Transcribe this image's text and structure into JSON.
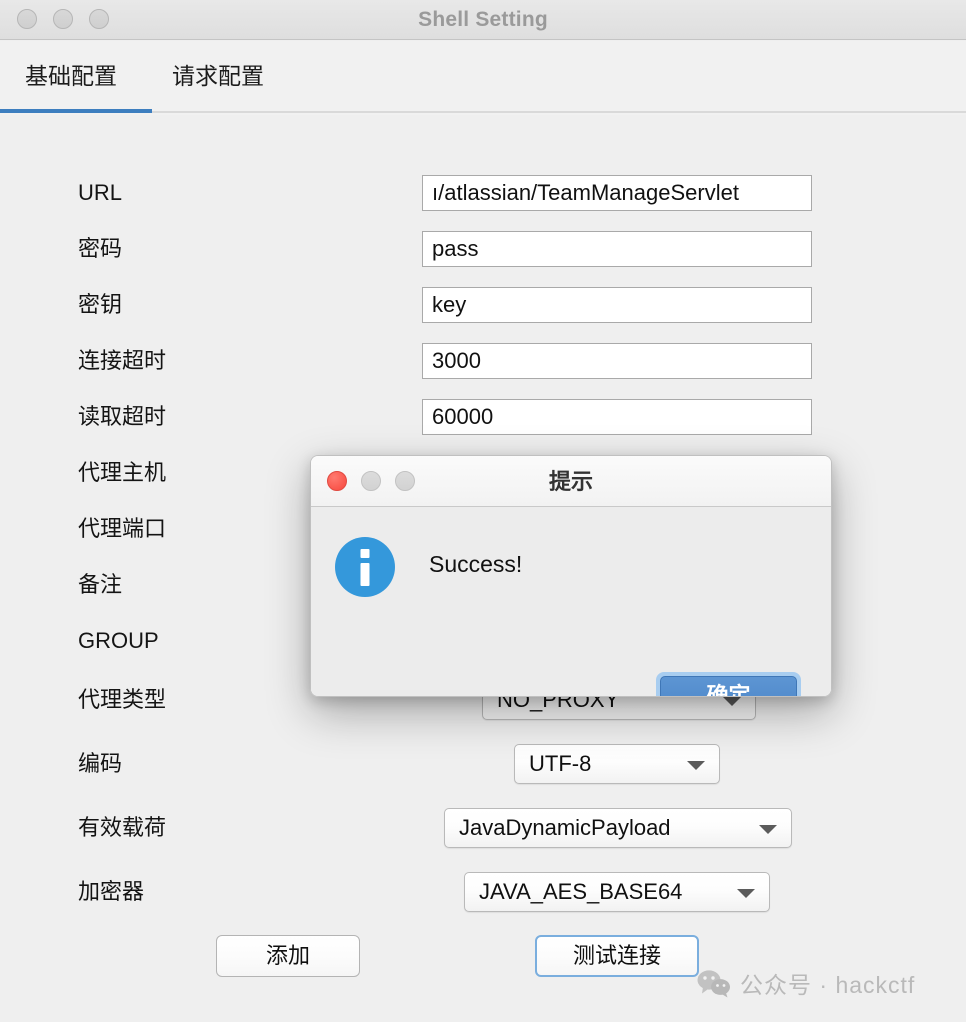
{
  "window": {
    "title": "Shell Setting",
    "traffic_lights": [
      "close-button",
      "minimize-button",
      "zoom-button"
    ]
  },
  "tabs": [
    {
      "label": "基础配置",
      "active": true
    },
    {
      "label": "请求配置",
      "active": false
    }
  ],
  "form": {
    "rows": [
      {
        "label": "URL",
        "type": "text",
        "value": "ı/atlassian/TeamManageServlet"
      },
      {
        "label": "密码",
        "type": "text",
        "value": "pass"
      },
      {
        "label": "密钥",
        "type": "text",
        "value": "key"
      },
      {
        "label": "连接超时",
        "type": "text",
        "value": "3000"
      },
      {
        "label": "读取超时",
        "type": "text",
        "value": "60000"
      },
      {
        "label": "代理主机",
        "type": "text",
        "value": ""
      },
      {
        "label": "代理端口",
        "type": "text",
        "value": ""
      },
      {
        "label": "备注",
        "type": "text",
        "value": ""
      },
      {
        "label": "GROUP",
        "type": "text",
        "value": ""
      },
      {
        "label": "代理类型",
        "type": "combo",
        "value": "NO_PROXY"
      },
      {
        "label": "编码",
        "type": "combo",
        "value": "UTF-8"
      },
      {
        "label": "有效载荷",
        "type": "combo",
        "value": "JavaDynamicPayload"
      },
      {
        "label": "加密器",
        "type": "combo",
        "value": "JAVA_AES_BASE64"
      }
    ]
  },
  "actions": {
    "add_label": "添加",
    "test_label": "测试连接"
  },
  "dialog": {
    "title": "提示",
    "message": "Success!",
    "ok_label": "确定",
    "icon": "info-icon",
    "traffic_lights": [
      "close-button",
      "minimize-button",
      "zoom-button"
    ]
  },
  "watermark": {
    "text": "公众号 · hackctf",
    "icon": "wechat-icon"
  },
  "colors": {
    "accent_blue": "#3d7ebf",
    "ok_button_blue": "#4b86c8",
    "focus_ring_blue": "#a8cdf0",
    "info_blue": "#3498db",
    "close_red": "#f9544a",
    "window_bg": "#efefef",
    "titlebar_bg": "#e4e4e4"
  }
}
